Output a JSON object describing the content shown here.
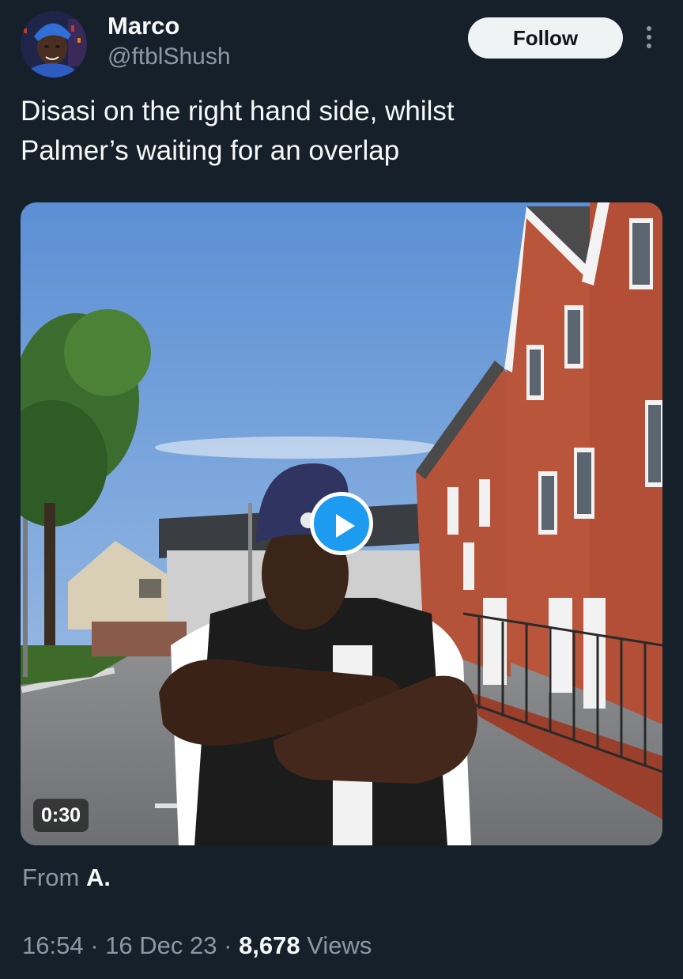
{
  "author": {
    "display_name": "Marco",
    "handle": "@ftblShush"
  },
  "follow_label": "Follow",
  "more_icon": "more-vertical-icon",
  "tweet": {
    "text_line1": "Disasi on the right hand side, whilst",
    "text_line2": "Palmer’s waiting for an overlap"
  },
  "video": {
    "duration": "0:30",
    "play_icon": "play-icon"
  },
  "attribution": {
    "prefix": "From",
    "user": "A."
  },
  "meta": {
    "time": "16:54",
    "separator": "·",
    "date": "16 Dec 23",
    "views_count": "8,678",
    "views_label": "Views"
  },
  "colors": {
    "background": "#15202b",
    "accent": "#1d9bf0",
    "text_primary": "#f7f9f9",
    "text_secondary": "#8b98a5"
  }
}
